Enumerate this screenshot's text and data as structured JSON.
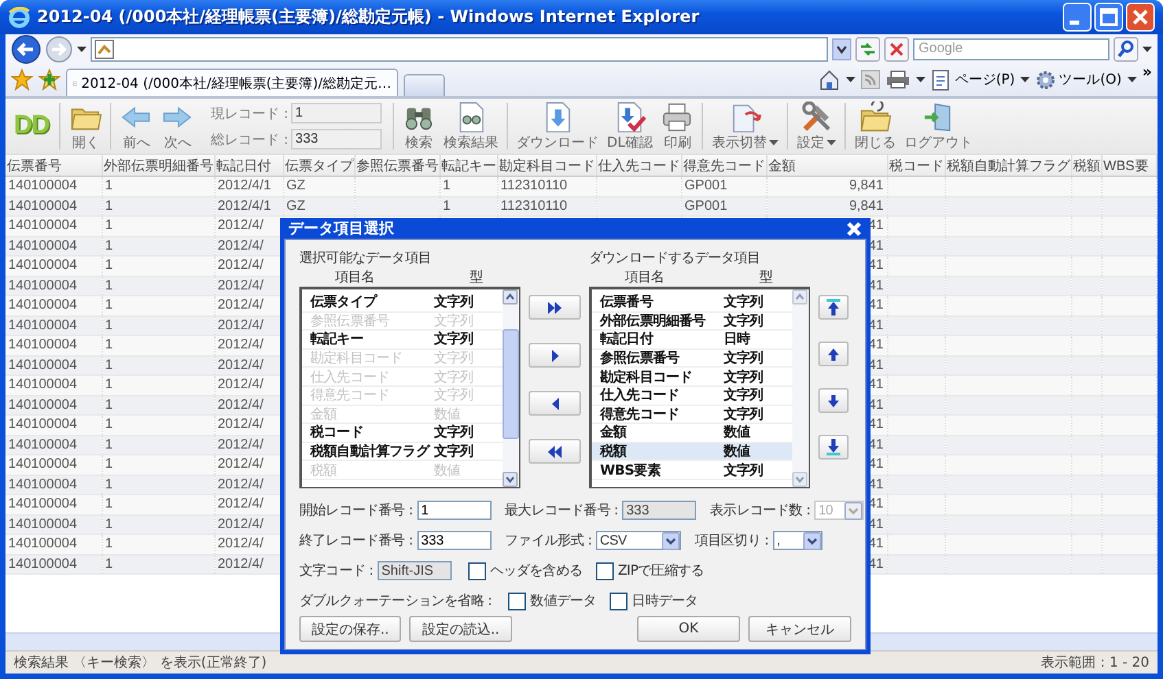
{
  "window": {
    "title": "2012-04 (/000本社/経理帳票(主要簿)/総勘定元帳) - Windows Internet Explorer"
  },
  "browser": {
    "search": {
      "placeholder": "Google"
    },
    "tabs": [
      {
        "label": "2012-04 (/000本社/経理帳票(主要簿)/総勘定元…",
        "selected": true
      }
    ],
    "commands": [
      {
        "label": "ページ(P)",
        "kind": "page"
      },
      {
        "label": "ツール(O)",
        "kind": "tools"
      }
    ],
    "chevron": "»"
  },
  "toolbar": {
    "logo": "DD",
    "nav_buttons": [
      {
        "label": "開く",
        "kind": "folder",
        "separator_before": true
      },
      {
        "label": "前へ",
        "kind": "back",
        "separator_before": true
      },
      {
        "label": "次へ",
        "kind": "forward",
        "separator_before": false
      }
    ],
    "record": [
      {
        "label": "現レコード :",
        "value": "1"
      },
      {
        "label": "総レコード :",
        "value": "333"
      }
    ],
    "action_buttons": [
      {
        "label": "検索",
        "kind": "binoculars",
        "dropdown": false,
        "separator_before": true
      },
      {
        "label": "検索結果",
        "kind": "search-results",
        "dropdown": false,
        "separator_before": false
      },
      {
        "label": "ダウンロード",
        "kind": "download",
        "dropdown": false,
        "separator_before": true
      },
      {
        "label": "DL確認",
        "kind": "download-check",
        "dropdown": false,
        "separator_before": false
      },
      {
        "label": "印刷",
        "kind": "printer",
        "dropdown": false,
        "separator_before": false
      },
      {
        "label": "表示切替",
        "kind": "switch",
        "dropdown": true,
        "separator_before": true
      },
      {
        "label": "設定",
        "kind": "tools",
        "dropdown": true,
        "separator_before": true
      },
      {
        "label": "閉じる",
        "kind": "close-folder",
        "dropdown": false,
        "separator_before": true
      },
      {
        "label": "ログアウト",
        "kind": "logout",
        "dropdown": false,
        "separator_before": false
      }
    ]
  },
  "table": {
    "columns": [
      "伝票番号",
      "外部伝票明細番号",
      "転記日付",
      "伝票タイプ",
      "参照伝票番号",
      "転記キー",
      "勘定科目コード",
      "仕入先コード",
      "得意先コード",
      "金額",
      "税コード",
      "税額自動計算フラグ",
      "税額",
      "WBS要"
    ],
    "rows": [
      [
        "140100004",
        "1",
        "2012/4/1",
        "GZ",
        null,
        "1",
        "112310110",
        null,
        "GP001",
        "9,841",
        null,
        null,
        null,
        null
      ],
      [
        "140100004",
        "1",
        "2012/4/1",
        "GZ",
        null,
        "1",
        "112310110",
        null,
        "GP001",
        "9,841",
        null,
        null,
        null,
        null
      ],
      [
        "140100004",
        "1",
        "2012/4/",
        null,
        null,
        null,
        null,
        null,
        null,
        "41",
        null,
        null,
        null,
        null
      ],
      [
        "140100004",
        "1",
        "2012/4/",
        null,
        null,
        null,
        null,
        null,
        null,
        "41",
        null,
        null,
        null,
        null
      ],
      [
        "140100004",
        "1",
        "2012/4/",
        null,
        null,
        null,
        null,
        null,
        null,
        "41",
        null,
        null,
        null,
        null
      ],
      [
        "140100004",
        "1",
        "2012/4/",
        null,
        null,
        null,
        null,
        null,
        null,
        "41",
        null,
        null,
        null,
        null
      ],
      [
        "140100004",
        "1",
        "2012/4/",
        null,
        null,
        null,
        null,
        null,
        null,
        "41",
        null,
        null,
        null,
        null
      ],
      [
        "140100004",
        "1",
        "2012/4/",
        null,
        null,
        null,
        null,
        null,
        null,
        "41",
        null,
        null,
        null,
        null
      ],
      [
        "140100004",
        "1",
        "2012/4/",
        null,
        null,
        null,
        null,
        null,
        null,
        "41",
        null,
        null,
        null,
        null
      ],
      [
        "140100004",
        "1",
        "2012/4/",
        null,
        null,
        null,
        null,
        null,
        null,
        "41",
        null,
        null,
        null,
        null
      ],
      [
        "140100004",
        "1",
        "2012/4/",
        null,
        null,
        null,
        null,
        null,
        null,
        "41",
        null,
        null,
        null,
        null
      ],
      [
        "140100004",
        "1",
        "2012/4/",
        null,
        null,
        null,
        null,
        null,
        null,
        "41",
        null,
        null,
        null,
        null
      ],
      [
        "140100004",
        "1",
        "2012/4/",
        null,
        null,
        null,
        null,
        null,
        null,
        "41",
        null,
        null,
        null,
        null
      ],
      [
        "140100004",
        "1",
        "2012/4/",
        null,
        null,
        null,
        null,
        null,
        null,
        "41",
        null,
        null,
        null,
        null
      ],
      [
        "140100004",
        "1",
        "2012/4/",
        null,
        null,
        null,
        null,
        null,
        null,
        "41",
        null,
        null,
        null,
        null
      ],
      [
        "140100004",
        "1",
        "2012/4/",
        null,
        null,
        null,
        null,
        null,
        null,
        "41",
        null,
        null,
        null,
        null
      ],
      [
        "140100004",
        "1",
        "2012/4/",
        null,
        null,
        null,
        null,
        null,
        null,
        "41",
        null,
        null,
        null,
        null
      ],
      [
        "140100004",
        "1",
        "2012/4/",
        null,
        null,
        null,
        null,
        null,
        null,
        "41",
        null,
        null,
        null,
        null
      ],
      [
        "140100004",
        "1",
        "2012/4/",
        null,
        null,
        null,
        null,
        null,
        null,
        "41",
        null,
        null,
        null,
        null
      ],
      [
        "140100004",
        "1",
        "2012/4/",
        null,
        null,
        null,
        null,
        null,
        null,
        "41",
        null,
        null,
        null,
        null
      ]
    ]
  },
  "status_bar": {
    "message": "検索結果 〈キー検索〉 を表示(正常終了)",
    "range": "表示範囲 : 1 - 20"
  },
  "dialog": {
    "title": "データ項目選択",
    "available": {
      "label": "選択可能なデータ項目",
      "headers": [
        "項目名",
        "型"
      ],
      "items": [
        {
          "name": "伝票タイプ",
          "type": "文字列",
          "enabled": true
        },
        {
          "name": "参照伝票番号",
          "type": "文字列",
          "enabled": false
        },
        {
          "name": "転記キー",
          "type": "文字列",
          "enabled": true
        },
        {
          "name": "勘定科目コード",
          "type": "文字列",
          "enabled": false
        },
        {
          "name": "仕入先コード",
          "type": "文字列",
          "enabled": false
        },
        {
          "name": "得意先コード",
          "type": "文字列",
          "enabled": false
        },
        {
          "name": "金額",
          "type": "数値",
          "enabled": false
        },
        {
          "name": "税コード",
          "type": "文字列",
          "enabled": true
        },
        {
          "name": "税額自動計算フラグ",
          "type": "文字列",
          "enabled": true
        },
        {
          "name": "税額",
          "type": "数値",
          "enabled": false
        }
      ]
    },
    "transfer_buttons": [
      {
        "kind": "add-all"
      },
      {
        "kind": "add"
      },
      {
        "kind": "remove"
      },
      {
        "kind": "remove-all"
      }
    ],
    "download": {
      "label": "ダウンロードするデータ項目",
      "headers": [
        "項目名",
        "型"
      ],
      "items": [
        {
          "name": "伝票番号",
          "type": "文字列",
          "selected": false
        },
        {
          "name": "外部伝票明細番号",
          "type": "文字列",
          "selected": false
        },
        {
          "name": "転記日付",
          "type": "日時",
          "selected": false
        },
        {
          "name": "参照伝票番号",
          "type": "文字列",
          "selected": false
        },
        {
          "name": "勘定科目コード",
          "type": "文字列",
          "selected": false
        },
        {
          "name": "仕入先コード",
          "type": "文字列",
          "selected": false
        },
        {
          "name": "得意先コード",
          "type": "文字列",
          "selected": false
        },
        {
          "name": "金額",
          "type": "数値",
          "selected": false
        },
        {
          "name": "税額",
          "type": "数値",
          "selected": true
        },
        {
          "name": "WBS要素",
          "type": "文字列",
          "selected": false
        }
      ]
    },
    "order_buttons": [
      {
        "kind": "top"
      },
      {
        "kind": "up"
      },
      {
        "kind": "down"
      },
      {
        "kind": "bottom"
      }
    ],
    "form_rows": [
      [
        {
          "kind": "text",
          "label": "開始レコード番号 :",
          "value": "1"
        },
        {
          "kind": "readonly",
          "label": "最大レコード番号 :",
          "value": "333"
        },
        {
          "kind": "select",
          "label": "表示レコード数 :",
          "value": "10",
          "disabled": true
        }
      ],
      [
        {
          "kind": "text",
          "label": "終了レコード番号 :",
          "value": "333"
        },
        {
          "kind": "select",
          "label": "ファイル形式 :",
          "value": "CSV",
          "disabled": false
        },
        {
          "kind": "select",
          "label": "項目区切り :",
          "value": ",",
          "disabled": false
        }
      ],
      [
        {
          "kind": "readonly",
          "label": "文字コード :",
          "value": "Shift-JIS"
        },
        {
          "kind": "checkbox",
          "label": "ヘッダを含める",
          "checked": false
        },
        {
          "kind": "checkbox",
          "label": "ZIPで圧縮する",
          "checked": false
        }
      ],
      [
        {
          "kind": "caption",
          "label": "ダブルクォーテーションを省略 :"
        },
        {
          "kind": "checkbox",
          "label": "数値データ",
          "checked": false
        },
        {
          "kind": "checkbox",
          "label": "日時データ",
          "checked": false
        }
      ]
    ],
    "left_buttons": [
      "設定の保存..",
      "設定の読込.."
    ],
    "right_buttons": [
      "OK",
      "キャンセル"
    ]
  }
}
